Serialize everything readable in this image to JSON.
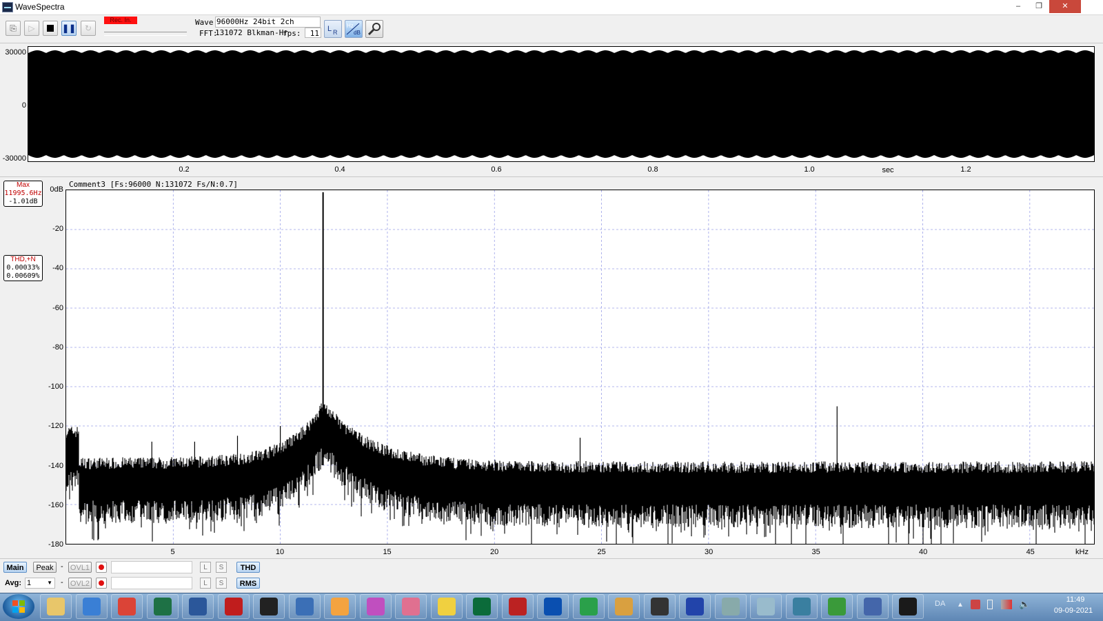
{
  "window": {
    "title": "WaveSpectra",
    "min": "–",
    "max": "❐",
    "close": "✕"
  },
  "toolbar": {
    "rec_label": "Rec. In.",
    "wave_label": "Wave:",
    "wave_value": "96000Hz 24bit 2ch",
    "fft_label": "FFT:",
    "fft_value": "131072 Blkman-Hr",
    "fps_label": "fps:",
    "fps_value": "11"
  },
  "waveform": {
    "y_ticks": [
      "30000",
      "0",
      "-30000"
    ],
    "x_ticks": [
      "0.2",
      "0.4",
      "0.6",
      "0.8",
      "1.0",
      "1.2"
    ],
    "x_unit": "sec"
  },
  "spectrum": {
    "comment": "Comment3  [Fs:96000 N:131072 Fs/N:0.7]",
    "max_label": "Max",
    "max_freq": "11995.6Hz",
    "max_db": "-1.01dB",
    "thd_label": "THD,+N",
    "thd_value": "0.00033%",
    "thdn_value": "0.00609%",
    "y_ticks": [
      "0dB",
      "-20",
      "-40",
      "-60",
      "-80",
      "-100",
      "-120",
      "-140",
      "-160",
      "-180"
    ],
    "x_ticks": [
      "5",
      "10",
      "15",
      "20",
      "25",
      "30",
      "35",
      "40",
      "45"
    ],
    "x_unit": "kHz"
  },
  "chart_data": {
    "type": "line",
    "title": "",
    "xlabel": "kHz",
    "ylabel": "dB",
    "xlim": [
      0,
      48
    ],
    "ylim": [
      -180,
      0
    ],
    "grid": true,
    "series": [
      {
        "x": [
          0.2,
          1,
          3,
          5,
          8,
          10,
          11,
          11.8,
          11.996,
          12.2,
          13,
          15,
          20,
          25,
          30,
          35,
          36,
          40,
          48
        ],
        "values": [
          -125,
          -145,
          -148,
          -146,
          -143,
          -135,
          -128,
          -118,
          -1.01,
          -118,
          -128,
          -138,
          -145,
          -148,
          -149,
          -149,
          -110,
          -148,
          -148
        ]
      }
    ]
  },
  "controls": {
    "main": "Main",
    "peak": "Peak",
    "avg_label": "Avg:",
    "avg_value": "1",
    "dash": "-",
    "ovl1": "OVL1",
    "ovl2": "OVL2",
    "l": "L",
    "s": "S",
    "thd": "THD",
    "rms": "RMS"
  },
  "taskbar": {
    "lang": "DA",
    "time": "11:49",
    "date": "09-09-2021",
    "apps": [
      "file-explorer",
      "thunderbird",
      "chrome",
      "excel",
      "writer",
      "acrobat",
      "app-round",
      "feather",
      "flower",
      "butterfly",
      "origami",
      "bulb",
      "green-app",
      "vt",
      "player",
      "waves",
      "tool",
      "spring",
      "e-app",
      "calculator",
      "eraser",
      "network",
      "pcb",
      "pa-app",
      "wavespectra"
    ]
  },
  "colors": {
    "accent": "#2a5ca8",
    "rec": "#ff1010",
    "readout": "#c00000",
    "grid": "#9aa0e8"
  }
}
